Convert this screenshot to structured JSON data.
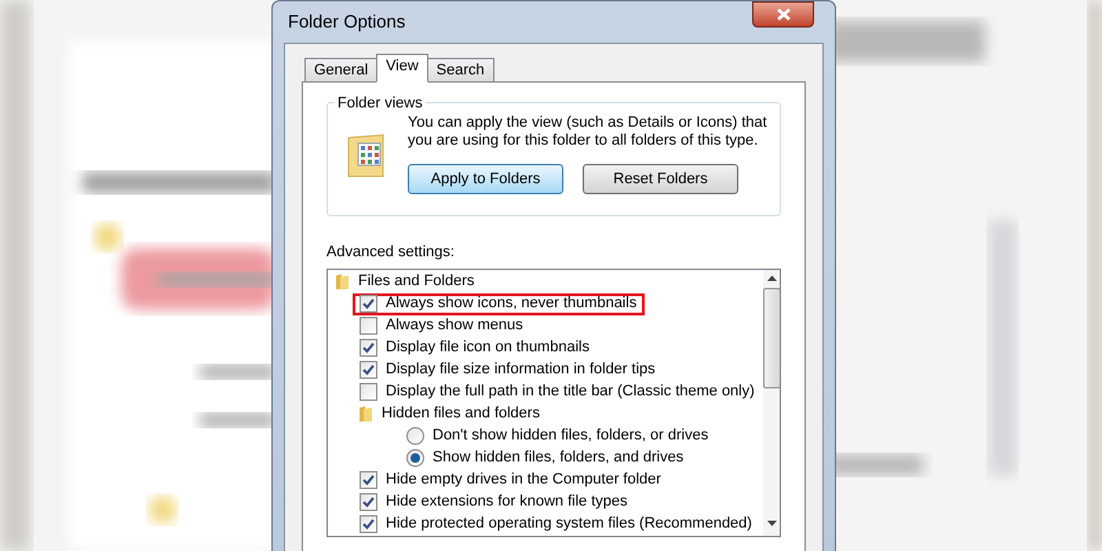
{
  "window": {
    "title": "Folder Options"
  },
  "tabs": [
    {
      "label": "General",
      "selected": false
    },
    {
      "label": "View",
      "selected": true
    },
    {
      "label": "Search",
      "selected": false
    }
  ],
  "folder_views": {
    "title": "Folder views",
    "description": "You can apply the view (such as Details or Icons) that you are using for this folder to all folders of this type.",
    "buttons": [
      {
        "label": "Apply to Folders",
        "focused": true
      },
      {
        "label": "Reset Folders",
        "focused": false
      }
    ]
  },
  "advanced_settings": {
    "label": "Advanced settings:",
    "items": [
      {
        "kind": "group",
        "label": "Files and Folders",
        "children": [
          {
            "kind": "checkbox",
            "label": "Always show icons, never thumbnails",
            "checked": true,
            "highlighted": true
          },
          {
            "kind": "checkbox",
            "label": "Always show menus",
            "checked": false,
            "highlighted": false
          },
          {
            "kind": "checkbox",
            "label": "Display file icon on thumbnails",
            "checked": true,
            "highlighted": false
          },
          {
            "kind": "checkbox",
            "label": "Display file size information in folder tips",
            "checked": true,
            "highlighted": false
          },
          {
            "kind": "checkbox",
            "label": "Display the full path in the title bar (Classic theme only)",
            "checked": false,
            "highlighted": false
          },
          {
            "kind": "group",
            "label": "Hidden files and folders",
            "children": [
              {
                "kind": "radio",
                "label": "Don't show hidden files, folders, or drives",
                "selected": false,
                "highlighted": false
              },
              {
                "kind": "radio",
                "label": "Show hidden files, folders, and drives",
                "selected": true,
                "highlighted": false
              }
            ]
          },
          {
            "kind": "checkbox",
            "label": "Hide empty drives in the Computer folder",
            "checked": true,
            "highlighted": false
          },
          {
            "kind": "checkbox",
            "label": "Hide extensions for known file types",
            "checked": true,
            "highlighted": false
          },
          {
            "kind": "checkbox",
            "label": "Hide protected operating system files (Recommended)",
            "checked": true,
            "highlighted": false
          }
        ]
      }
    ]
  }
}
